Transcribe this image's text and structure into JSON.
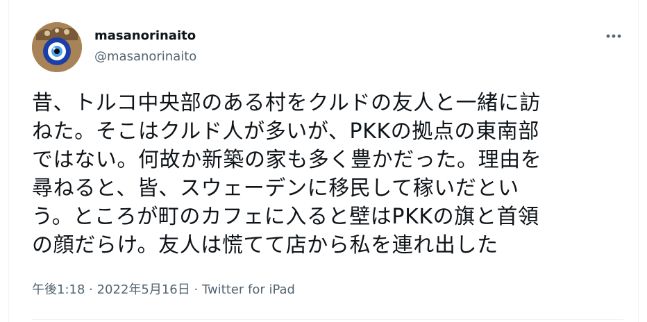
{
  "user": {
    "display_name": "masanorinaito",
    "handle": "@masanorinaito",
    "avatar_icon": "nazar-evil-eye-icon"
  },
  "more_icon": "more-horizontal-icon",
  "tweet": {
    "text": "昔、トルコ中央部のある村をクルドの友人と一緒に訪\nねた。そこはクルド人が多いが、PKKの拠点の東南部\nではない。何故か新築の家も多く豊かだった。理由を\n尋ねると、皆、スウェーデンに移民して稼いだとい\nう。ところが町のカフェに入ると壁はPKKの旗と首領\nの顔だらけ。友人は慌てて店から私を連れ出した"
  },
  "meta": {
    "time": "午後1:18",
    "separator": " · ",
    "date": "2022年5月16日",
    "source": "Twitter for iPad"
  },
  "colors": {
    "text_primary": "#0f1419",
    "text_secondary": "#536471",
    "divider": "#eff3f4"
  }
}
